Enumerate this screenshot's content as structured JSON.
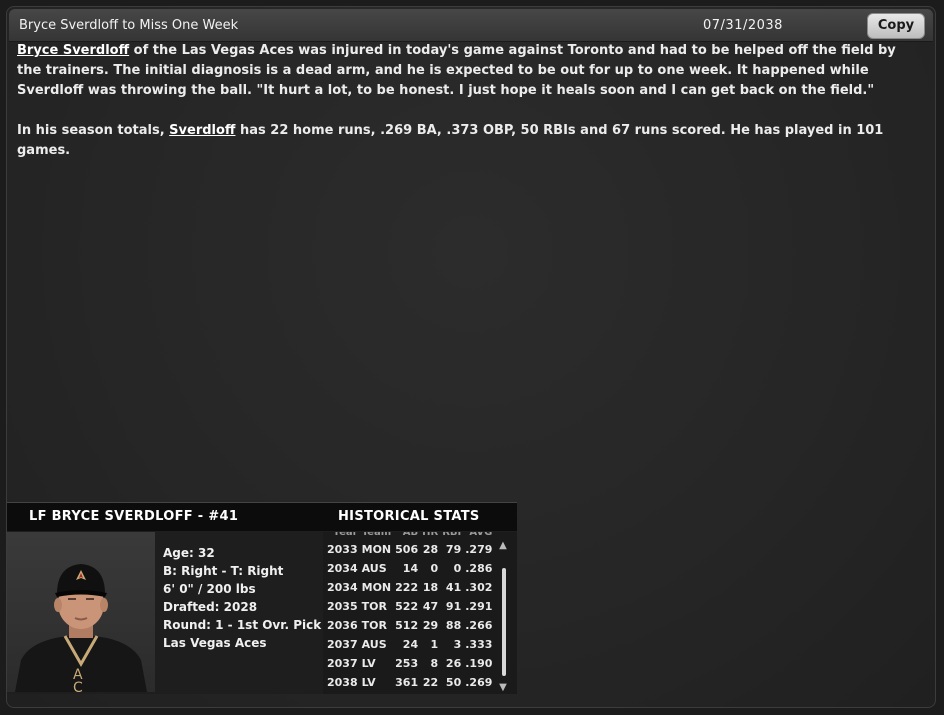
{
  "header": {
    "title": "Bryce Sverdloff to Miss One Week",
    "date": "07/31/2038",
    "copy_label": "Copy"
  },
  "article": {
    "p1_link": "Bryce Sverdloff",
    "p1_text": " of the Las Vegas Aces was injured in today's game against Toronto and had to be helped off the field by the trainers. The initial diagnosis is a dead arm, and he is expected to be out for up to one week. It happened while Sverdloff was throwing the ball. \"It hurt a lot, to be honest. I just hope it heals soon and I can get back on the field.\"",
    "p2_pre": "In his season totals, ",
    "p2_link": "Sverdloff",
    "p2_text": " has 22 home runs, .269 BA, .373 OBP, 50 RBIs and 67 runs scored. He has played in 101 games."
  },
  "player_card": {
    "name_header": "LF BRYCE SVERDLOFF - #41",
    "stats_header": "HISTORICAL STATS",
    "bio": {
      "age": "Age: 32",
      "bats_throws": "B: Right - T: Right",
      "height_weight": "6' 0\" / 200 lbs",
      "drafted": "Drafted: 2028",
      "round": "Round: 1 - 1st Ovr. Pick",
      "team": "Las Vegas Aces"
    },
    "stats_columns": [
      "Year",
      "Team",
      "AB",
      "HR",
      "RBI",
      "AVG"
    ],
    "stats_rows": [
      [
        "2033",
        "MON",
        "506",
        "28",
        "79",
        ".279"
      ],
      [
        "2034",
        "AUS",
        "14",
        "0",
        "0",
        ".286"
      ],
      [
        "2034",
        "MON",
        "222",
        "18",
        "41",
        ".302"
      ],
      [
        "2035",
        "TOR",
        "522",
        "47",
        "91",
        ".291"
      ],
      [
        "2036",
        "TOR",
        "512",
        "29",
        "88",
        ".266"
      ],
      [
        "2037",
        "AUS",
        "24",
        "1",
        "3",
        ".333"
      ],
      [
        "2037",
        "LV",
        "253",
        "8",
        "26",
        ".190"
      ],
      [
        "2038",
        "LV",
        "361",
        "22",
        "50",
        ".269"
      ]
    ]
  },
  "colors": {
    "background": "#262626",
    "titlebar": "#3e3e3e",
    "card_header": "#0c0c0c",
    "jersey": "#1a1a1a",
    "jersey_trim": "#c8aa78"
  },
  "icons": {
    "scroll_up": "chevron-up-icon",
    "scroll_down": "chevron-down-icon"
  }
}
